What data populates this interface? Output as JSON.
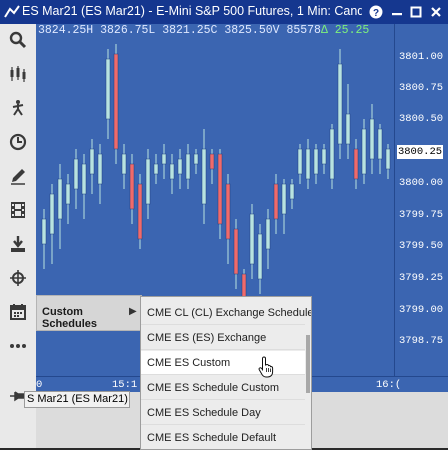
{
  "window": {
    "title": "ES Mar21 (ES Mar21) - E-Mini S&P 500 Futures, 1 Min: Cand...",
    "help_icon": "question-circle-icon",
    "minimize_icon": "minimize-icon",
    "maximize_icon": "maximize-icon",
    "close_icon": "close-icon"
  },
  "toolbar": {
    "tools": [
      "search-icon",
      "candlestick-icon",
      "drawing-person-icon",
      "clock-icon",
      "pencil-icon",
      "film-strip-icon",
      "download-icon",
      "crosshair-icon",
      "calendar-icon",
      "more-icon",
      "pin-icon"
    ]
  },
  "chart": {
    "ohlc_prefix": "3824.25H 3826.75L 3821.25C 3825.50V 85578",
    "change_arrow": "Δ",
    "change_value": "25.25",
    "price_ticks": [
      "3801.00",
      "3800.75",
      "3800.50",
      "3800.00",
      "3799.75",
      "3799.50",
      "3799.25",
      "3799.00",
      "3798.75"
    ],
    "last_price": "3800.25",
    "time_labels": [
      "0",
      "15:1",
      "16:("
    ],
    "instrument": "S Mar21 (ES Mar21)",
    "colors": {
      "background": "#3b65b1",
      "up_candle": "#b8e3e0",
      "down_candle": "#f06a6a"
    }
  },
  "menu": {
    "label": "Custom Schedules",
    "arrow": "▶",
    "items": [
      "CME CL (CL) Exchange Schedule",
      "CME ES (ES) Exchange",
      "CME ES Custom",
      "CME ES Schedule Custom",
      "CME ES Schedule Day",
      "CME ES Schedule Default"
    ],
    "hovered_index": 2
  }
}
